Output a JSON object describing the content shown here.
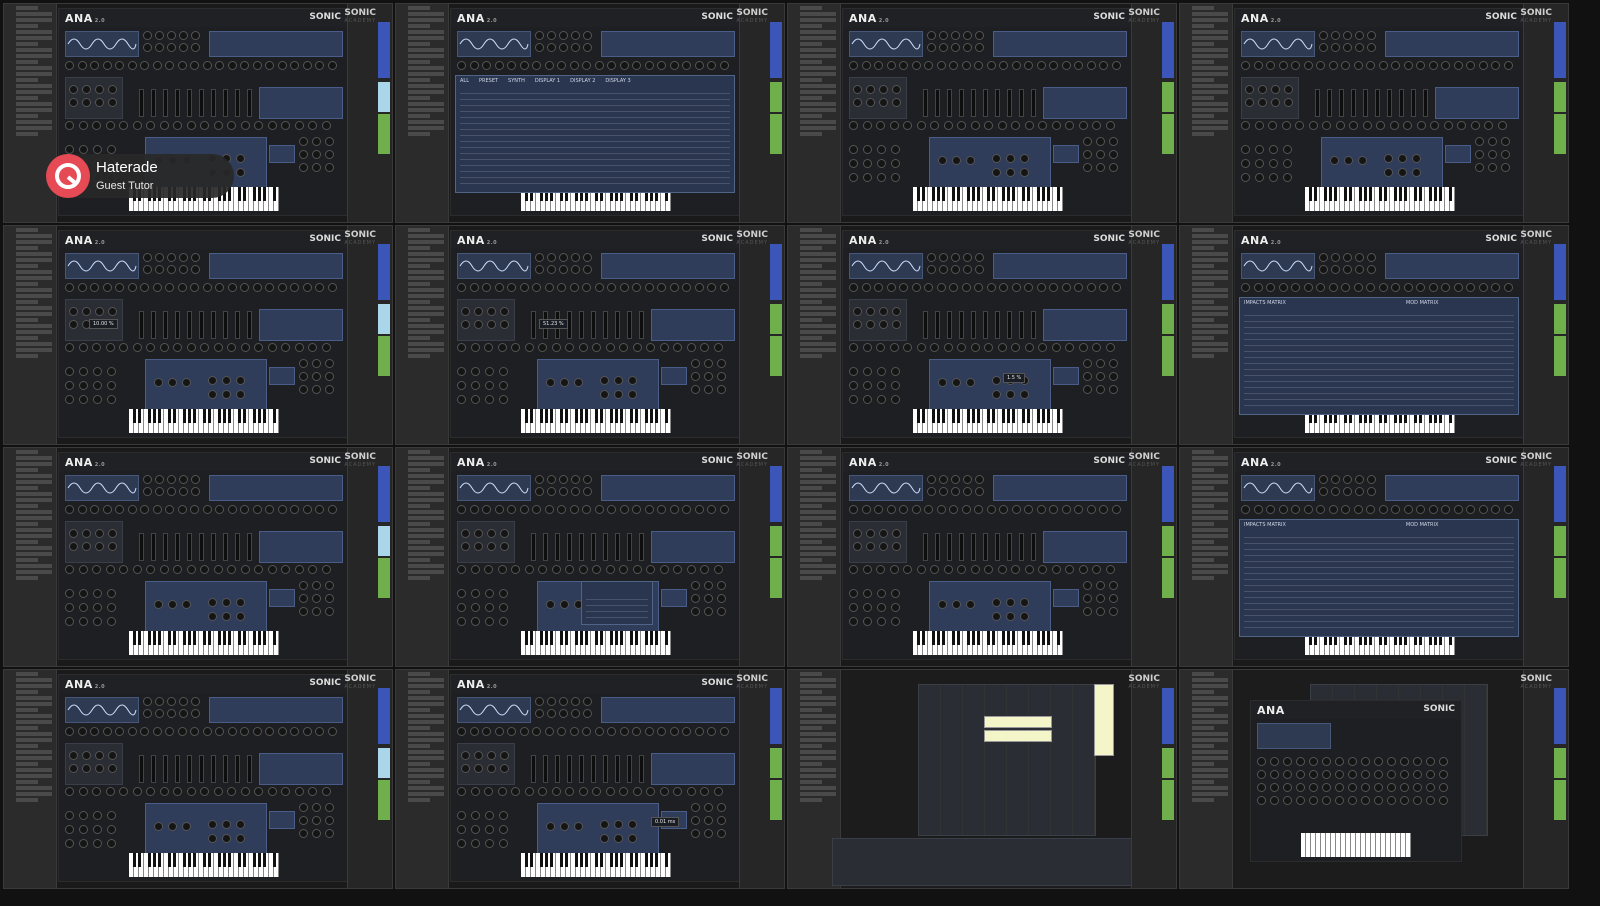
{
  "tutor_badge": {
    "name": "Haterade",
    "role": "Guest Tutor",
    "accent": "#e54a55"
  },
  "plugin": {
    "name": "ANA",
    "version": "2.0",
    "brand": "SONIC"
  },
  "side_brand": {
    "main": "SONIC",
    "sub": "ACADEMY"
  },
  "overlays": {
    "browser_tabs": [
      "ALL",
      "PRESET",
      "SYNTH",
      "DISPLAY 1",
      "DISPLAY 2",
      "DISPLAY 3"
    ],
    "matrix_left": "IMPACTS MATRIX",
    "matrix_right": "MOD MATRIX"
  },
  "value_popups": [
    "10.00 %",
    "51.23 %",
    "1.5 %",
    "0.01 ms"
  ],
  "colors": {
    "track_blue": "#3b55b8",
    "track_green": "#6fb04c",
    "track_light": "#a9d6e8",
    "clip": "#f4f5c8"
  }
}
